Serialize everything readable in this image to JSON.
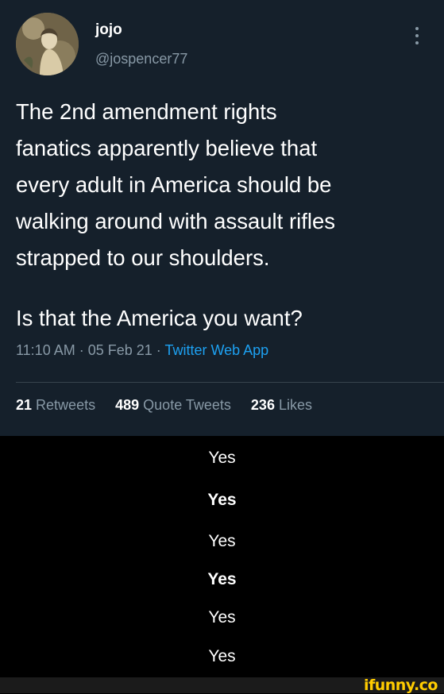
{
  "tweet": {
    "display_name": "jojo",
    "handle": "@jospencer77",
    "text_lines": [
      "The 2nd amendment rights",
      "fanatics apparently believe that",
      "every adult in America should be",
      "walking around with assault rifles",
      "strapped to our shoulders."
    ],
    "question": "Is that the America you want?",
    "time": "11:10 AM",
    "date": "05 Feb 21",
    "source": "Twitter Web App",
    "separator": " · ",
    "retweets_count": "21",
    "retweets_label": "Retweets",
    "quote_tweets_count": "489",
    "quote_tweets_label": "Quote Tweets",
    "likes_count": "236",
    "likes_label": "Likes",
    "colors": {
      "background": "#15202b",
      "text": "#ffffff",
      "secondary": "#8899a6",
      "link": "#1da1f2"
    }
  },
  "replies": [
    "Yes",
    "Yes",
    "Yes",
    "Yes",
    "Yes",
    "Yes"
  ],
  "watermark": {
    "text": "ifunny.co",
    "color": "#ffcc00"
  }
}
